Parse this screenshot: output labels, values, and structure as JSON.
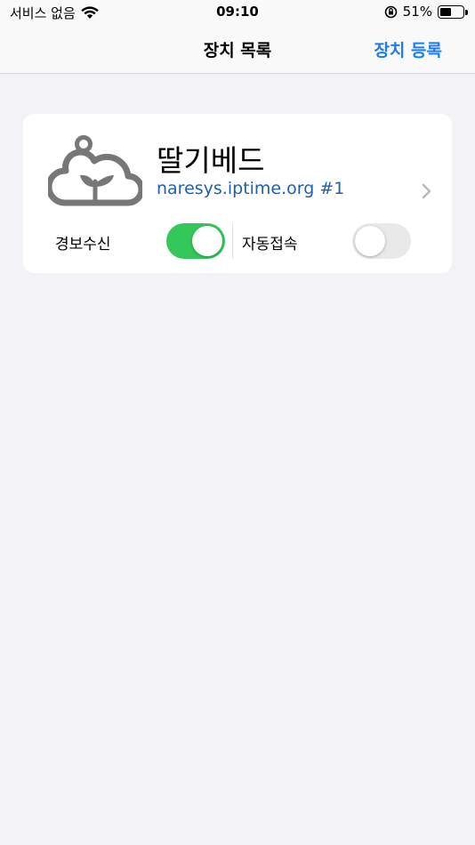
{
  "status": {
    "carrier": "서비스 없음",
    "time": "09:10",
    "battery_percent": "51%",
    "battery_level": 0.51
  },
  "nav": {
    "title": "장치 목록",
    "action": "장치 등록",
    "accent": "#1a7df5"
  },
  "device": {
    "name": "딸기베드",
    "address": "naresys.iptime.org #1",
    "alarm": {
      "label": "경보수신",
      "on": true
    },
    "auto_connect": {
      "label": "자동접속",
      "on": false
    }
  },
  "colors": {
    "switch_on": "#34c759",
    "link": "#1f5fb0",
    "background": "#f2f2f7"
  }
}
